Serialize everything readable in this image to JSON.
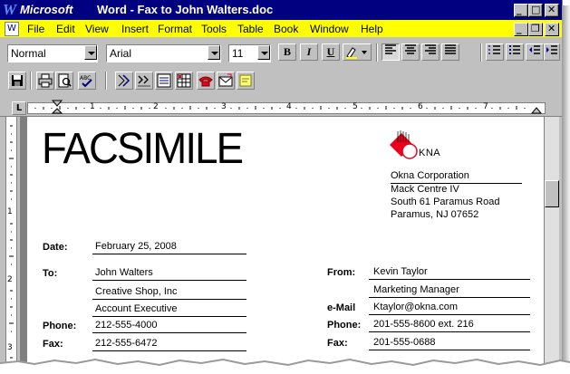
{
  "window": {
    "app_name": "Microsoft",
    "title": " Word - Fax to John Walters.doc",
    "app_icon": "word-w-icon"
  },
  "menu": {
    "items": [
      "File",
      "Edit",
      "View",
      "Insert",
      "Format",
      "Tools",
      "Table",
      "Book",
      "Window",
      "Help"
    ]
  },
  "formatting": {
    "style": "Normal",
    "font": "Arial",
    "size": "11",
    "bold": "B",
    "italic": "I",
    "underline": "U"
  },
  "ruler": {
    "numbers": [
      "1",
      "2",
      "3",
      "4",
      "5",
      "6",
      "7"
    ]
  },
  "vruler": {
    "numbers": [
      "1",
      "2",
      "3"
    ]
  },
  "document": {
    "heading": "FACSIMILE",
    "company_logo_text": "KNA",
    "company": {
      "name": "Okna Corporation",
      "line2": "Mack Centre IV",
      "line3": "South 61 Paramus Road",
      "line4": "Paramus, NJ 07652"
    },
    "date_label": "Date:",
    "date": "February 25, 2008",
    "to_label": "To:",
    "to_name": "John Walters",
    "to_company": "Creative Shop, Inc",
    "to_title": "Account Executive",
    "phone_label": "Phone:",
    "to_phone": "212-555-4000",
    "fax_label": "Fax:",
    "to_fax": "212-555-6472",
    "from_label": "From:",
    "from_name": "Kevin Taylor",
    "from_title": "Marketing Manager",
    "email_label": "e-Mail",
    "from_email": "Ktaylor@okna.com",
    "from_phone_label": "Phone:",
    "from_phone": "201-555-8600 ext. 216",
    "from_fax_label": "Fax:",
    "from_fax": "201-555-0688"
  },
  "colors": {
    "titlebar": "#000080",
    "menubar": "#ffff00",
    "logo_red": "#e8001c"
  }
}
